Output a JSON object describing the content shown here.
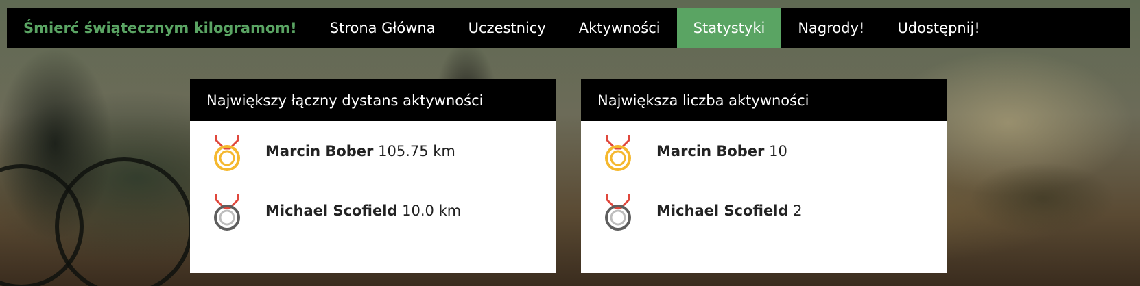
{
  "navbar": {
    "brand": "Śmierć świątecznym kilogramom!",
    "items": [
      {
        "label": "Strona Główna",
        "active": false
      },
      {
        "label": "Uczestnicy",
        "active": false
      },
      {
        "label": "Aktywności",
        "active": false
      },
      {
        "label": "Statystyki",
        "active": true
      },
      {
        "label": "Nagrody!",
        "active": false
      },
      {
        "label": "Udostępnij!",
        "active": false
      }
    ]
  },
  "colors": {
    "accent": "#5aa463",
    "gold": "#f5b82e",
    "silver": "#9a9a9a",
    "ribbon": "#e0473c"
  },
  "stats": {
    "distance": {
      "title": "Największy łączny dystans aktywności",
      "entries": [
        {
          "medal": "gold-medal-icon",
          "name": "Marcin Bober",
          "value": "105.75 km"
        },
        {
          "medal": "silver-medal-icon",
          "name": "Michael Scofield",
          "value": "10.0 km"
        }
      ]
    },
    "count": {
      "title": "Największa liczba aktywności",
      "entries": [
        {
          "medal": "gold-medal-icon",
          "name": "Marcin Bober",
          "value": "10"
        },
        {
          "medal": "silver-medal-icon",
          "name": "Michael Scofield",
          "value": "2"
        }
      ]
    }
  }
}
